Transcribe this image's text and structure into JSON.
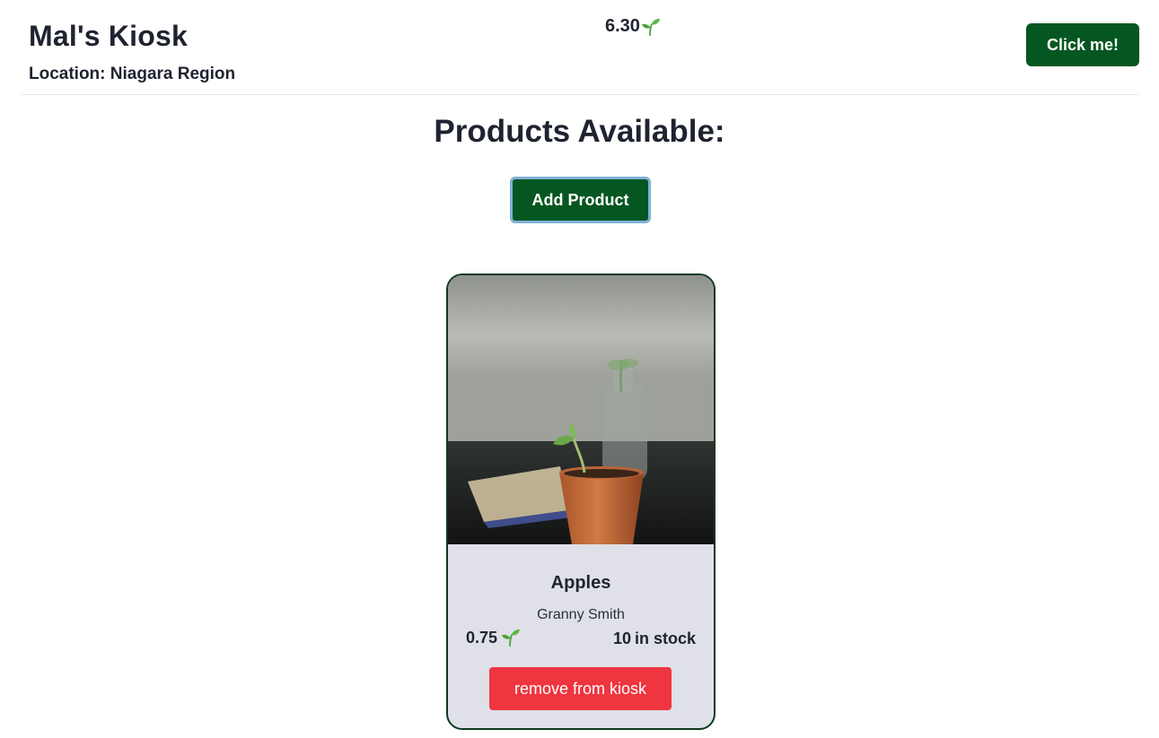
{
  "header": {
    "kiosk_name": "Mal's Kiosk",
    "location": "Location: Niagara Region",
    "balance": "6.30",
    "currency_icon": "sprout-icon",
    "click_button_label": "Click me!"
  },
  "main": {
    "title": "Products Available:",
    "add_product_label": "Add Product"
  },
  "products": [
    {
      "name": "Apples",
      "variety": "Granny Smith",
      "price": "0.75",
      "stock_count": "10",
      "stock_suffix": "in stock",
      "remove_label": "remove from kiosk"
    }
  ],
  "colors": {
    "primary_green": "#045720",
    "remove_red": "#ef353f",
    "card_bg": "#dfe0e8",
    "sprout_green": "#4aa33a"
  }
}
